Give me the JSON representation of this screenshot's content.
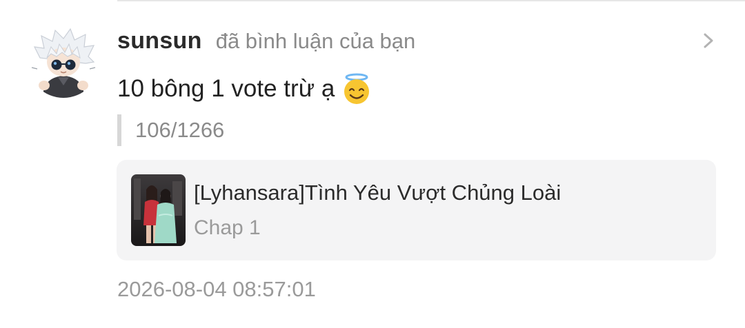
{
  "notification": {
    "username": "sunsun",
    "action_text": "đã bình luận của bạn",
    "comment_text": "10 bông 1 vote trừ ạ",
    "comment_emoji": "smiling-face-with-halo-icon",
    "quote_text": "106/1266",
    "timestamp": "2026-08-04 08:57:01"
  },
  "story_card": {
    "title": "[Lyhansara]Tình Yêu Vượt Chủng Loài",
    "chapter": "Chap 1"
  },
  "icons": {
    "avatar": "anime-character-avatar",
    "navigate": "chevron-right-icon",
    "thumbnail": "story-cover-thumbnail"
  },
  "colors": {
    "background": "#ffffff",
    "card_background": "#f4f4f5",
    "primary_text": "#222222",
    "secondary_text": "#8a8a8a",
    "quote_bar": "#d7d7d7"
  }
}
